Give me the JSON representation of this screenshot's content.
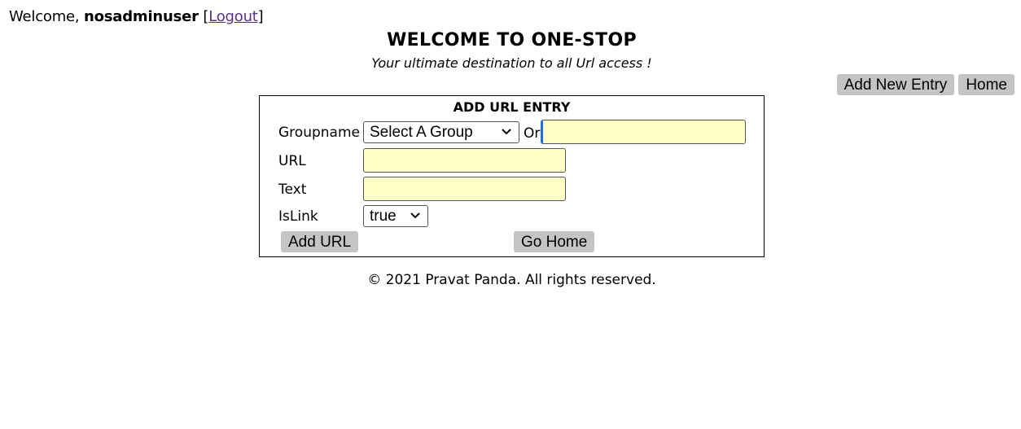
{
  "header": {
    "welcome_prefix": "Welcome, ",
    "username": "nosadminuser",
    "bracket_open": "[",
    "logout_label": "Logout",
    "bracket_close": "]"
  },
  "title": "WELCOME TO ONE-STOP",
  "subtitle": "Your ultimate destination to all Url access !",
  "top_buttons": {
    "add_new_entry": "Add New Entry",
    "home": "Home"
  },
  "form": {
    "title": "ADD URL ENTRY",
    "groupname_label": "Groupname",
    "group_select_value": "Select A Group",
    "or_label": "Or",
    "new_group_value": "",
    "url_label": "URL",
    "url_value": "",
    "text_label": "Text",
    "text_value": "",
    "islink_label": "IsLink",
    "islink_value": "true",
    "add_url_button": "Add URL",
    "go_home_button": "Go Home"
  },
  "footer": "© 2021 Pravat Panda. All rights reserved.",
  "colors": {
    "input_bg": "#ffffc6",
    "button_bg": "#c4c4c4",
    "focus_accent": "#1e6fe0",
    "link": "#5a2f8a"
  },
  "icons": {
    "select_arrow": "chevron-down-icon"
  }
}
